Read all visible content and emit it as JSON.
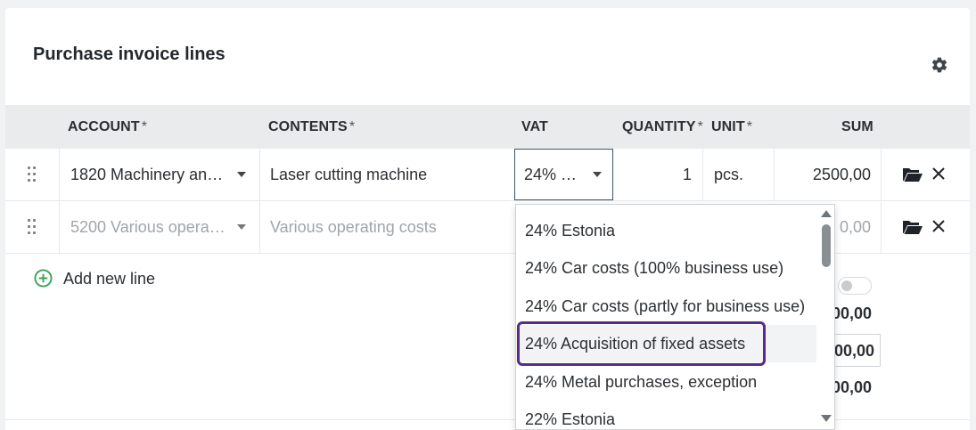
{
  "panel": {
    "title": "Purchase invoice lines",
    "settings_icon": "gear-icon"
  },
  "columns": {
    "account": "ACCOUNT",
    "contents": "CONTENTS",
    "vat": "VAT",
    "quantity": "QUANTITY",
    "unit": "UNIT",
    "sum": "SUM",
    "required_mark": "*"
  },
  "rows": [
    {
      "account": "1820 Machinery an…",
      "contents": "Laser cutting machine",
      "vat": "24% …",
      "quantity": "1",
      "unit": "pcs.",
      "sum": "2500,00"
    },
    {
      "account": "5200 Various opera…",
      "contents": "Various operating costs",
      "sum": "0,00"
    }
  ],
  "add_line_label": "Add new line",
  "totals": [
    "00,00",
    "00,00",
    "00,00"
  ],
  "vat_dropdown": {
    "options": [
      "24% Estonia",
      "24% Car costs (100% business use)",
      "24% Car costs (partly for business use)",
      "24% Acquisition of fixed assets",
      "24% Metal purchases, exception",
      "22% Estonia"
    ],
    "highlighted_option": "24% Acquisition of fixed assets"
  },
  "colors": {
    "accent_green": "#3aa35a",
    "focus_purple": "#5b2a86",
    "header_bg": "#e9ebec"
  }
}
